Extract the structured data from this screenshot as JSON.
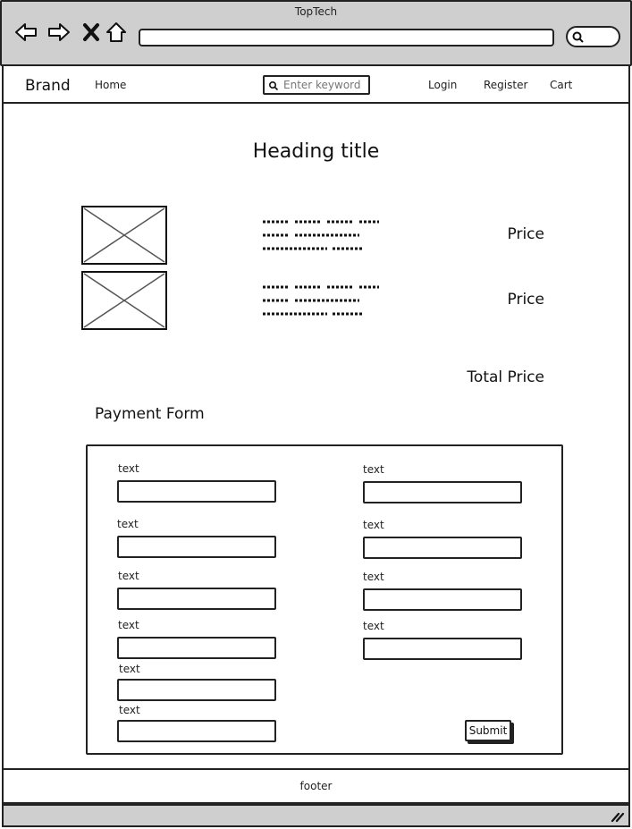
{
  "browser": {
    "window_title": "TopTech",
    "icons": [
      "back-arrow-icon",
      "forward-arrow-icon",
      "close-icon",
      "home-icon",
      "search-icon"
    ]
  },
  "navbar": {
    "brand": "Brand",
    "home": "Home",
    "search_placeholder": "Enter keyword",
    "login": "Login",
    "register": "Register",
    "cart": "Cart"
  },
  "main": {
    "heading": "Heading title",
    "items": [
      {
        "price": "Price"
      },
      {
        "price": "Price"
      }
    ],
    "total_price": "Total Price"
  },
  "payment_form": {
    "title": "Payment Form",
    "fields": [
      {
        "label": "text"
      },
      {
        "label": "text"
      },
      {
        "label": "text"
      },
      {
        "label": "text"
      },
      {
        "label": "text"
      },
      {
        "label": "text"
      },
      {
        "label": "text"
      },
      {
        "label": "text"
      },
      {
        "label": "text"
      },
      {
        "label": "text"
      }
    ],
    "submit": "Submit"
  },
  "footer": {
    "text": "footer"
  }
}
